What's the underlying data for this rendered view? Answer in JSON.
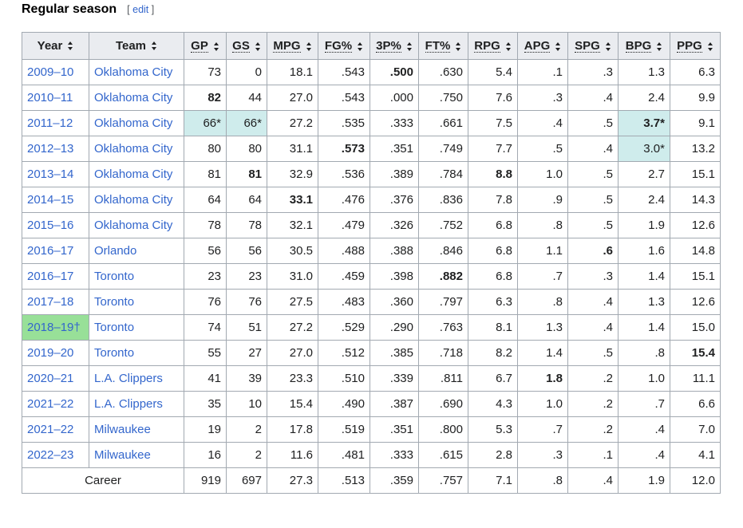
{
  "section": {
    "title": "Regular season",
    "edit_open": "[",
    "edit_label": "edit",
    "edit_close": "]"
  },
  "columns": [
    "Year",
    "Team",
    "GP",
    "GS",
    "MPG",
    "FG%",
    "3P%",
    "FT%",
    "RPG",
    "APG",
    "SPG",
    "BPG",
    "PPG"
  ],
  "colors": {
    "league_leader": "#cfecec",
    "champion": "#98e098",
    "link": "#3366cc",
    "header_bg": "#eaecf0",
    "border": "#a2a9b1"
  },
  "rows": [
    {
      "year": "2009–10",
      "team": "Oklahoma City",
      "gp": "73",
      "gs": "0",
      "mpg": "18.1",
      "fg": ".543",
      "tp": ".500",
      "ft": ".630",
      "rpg": "5.4",
      "apg": ".1",
      "spg": ".3",
      "bpg": "1.3",
      "ppg": "6.3"
    },
    {
      "year": "2010–11",
      "team": "Oklahoma City",
      "gp": "82",
      "gs": "44",
      "mpg": "27.0",
      "fg": ".543",
      "tp": ".000",
      "ft": ".750",
      "rpg": "7.6",
      "apg": ".3",
      "spg": ".4",
      "bpg": "2.4",
      "ppg": "9.9"
    },
    {
      "year": "2011–12",
      "team": "Oklahoma City",
      "gp": "66*",
      "gs": "66*",
      "mpg": "27.2",
      "fg": ".535",
      "tp": ".333",
      "ft": ".661",
      "rpg": "7.5",
      "apg": ".4",
      "spg": ".5",
      "bpg": "3.7*",
      "ppg": "9.1"
    },
    {
      "year": "2012–13",
      "team": "Oklahoma City",
      "gp": "80",
      "gs": "80",
      "mpg": "31.1",
      "fg": ".573",
      "tp": ".351",
      "ft": ".749",
      "rpg": "7.7",
      "apg": ".5",
      "spg": ".4",
      "bpg": "3.0*",
      "ppg": "13.2"
    },
    {
      "year": "2013–14",
      "team": "Oklahoma City",
      "gp": "81",
      "gs": "81",
      "mpg": "32.9",
      "fg": ".536",
      "tp": ".389",
      "ft": ".784",
      "rpg": "8.8",
      "apg": "1.0",
      "spg": ".5",
      "bpg": "2.7",
      "ppg": "15.1"
    },
    {
      "year": "2014–15",
      "team": "Oklahoma City",
      "gp": "64",
      "gs": "64",
      "mpg": "33.1",
      "fg": ".476",
      "tp": ".376",
      "ft": ".836",
      "rpg": "7.8",
      "apg": ".9",
      "spg": ".5",
      "bpg": "2.4",
      "ppg": "14.3"
    },
    {
      "year": "2015–16",
      "team": "Oklahoma City",
      "gp": "78",
      "gs": "78",
      "mpg": "32.1",
      "fg": ".479",
      "tp": ".326",
      "ft": ".752",
      "rpg": "6.8",
      "apg": ".8",
      "spg": ".5",
      "bpg": "1.9",
      "ppg": "12.6"
    },
    {
      "year": "2016–17",
      "team": "Orlando",
      "gp": "56",
      "gs": "56",
      "mpg": "30.5",
      "fg": ".488",
      "tp": ".388",
      "ft": ".846",
      "rpg": "6.8",
      "apg": "1.1",
      "spg": ".6",
      "bpg": "1.6",
      "ppg": "14.8"
    },
    {
      "year": "2016–17",
      "team": "Toronto",
      "gp": "23",
      "gs": "23",
      "mpg": "31.0",
      "fg": ".459",
      "tp": ".398",
      "ft": ".882",
      "rpg": "6.8",
      "apg": ".7",
      "spg": ".3",
      "bpg": "1.4",
      "ppg": "15.1"
    },
    {
      "year": "2017–18",
      "team": "Toronto",
      "gp": "76",
      "gs": "76",
      "mpg": "27.5",
      "fg": ".483",
      "tp": ".360",
      "ft": ".797",
      "rpg": "6.3",
      "apg": ".8",
      "spg": ".4",
      "bpg": "1.3",
      "ppg": "12.6"
    },
    {
      "year": "2018–19†",
      "team": "Toronto",
      "gp": "74",
      "gs": "51",
      "mpg": "27.2",
      "fg": ".529",
      "tp": ".290",
      "ft": ".763",
      "rpg": "8.1",
      "apg": "1.3",
      "spg": ".4",
      "bpg": "1.4",
      "ppg": "15.0"
    },
    {
      "year": "2019–20",
      "team": "Toronto",
      "gp": "55",
      "gs": "27",
      "mpg": "27.0",
      "fg": ".512",
      "tp": ".385",
      "ft": ".718",
      "rpg": "8.2",
      "apg": "1.4",
      "spg": ".5",
      "bpg": ".8",
      "ppg": "15.4"
    },
    {
      "year": "2020–21",
      "team": "L.A. Clippers",
      "gp": "41",
      "gs": "39",
      "mpg": "23.3",
      "fg": ".510",
      "tp": ".339",
      "ft": ".811",
      "rpg": "6.7",
      "apg": "1.8",
      "spg": ".2",
      "bpg": "1.0",
      "ppg": "11.1"
    },
    {
      "year": "2021–22",
      "team": "L.A. Clippers",
      "gp": "35",
      "gs": "10",
      "mpg": "15.4",
      "fg": ".490",
      "tp": ".387",
      "ft": ".690",
      "rpg": "4.3",
      "apg": "1.0",
      "spg": ".2",
      "bpg": ".7",
      "ppg": "6.6"
    },
    {
      "year": "2021–22",
      "team": "Milwaukee",
      "gp": "19",
      "gs": "2",
      "mpg": "17.8",
      "fg": ".519",
      "tp": ".351",
      "ft": ".800",
      "rpg": "5.3",
      "apg": ".7",
      "spg": ".2",
      "bpg": ".4",
      "ppg": "7.0"
    },
    {
      "year": "2022–23",
      "team": "Milwaukee",
      "gp": "16",
      "gs": "2",
      "mpg": "11.6",
      "fg": ".481",
      "tp": ".333",
      "ft": ".615",
      "rpg": "2.8",
      "apg": ".3",
      "spg": ".1",
      "bpg": ".4",
      "ppg": "4.1"
    }
  ],
  "career": {
    "label": "Career",
    "gp": "919",
    "gs": "697",
    "mpg": "27.3",
    "fg": ".513",
    "tp": ".359",
    "ft": ".757",
    "rpg": "7.1",
    "apg": ".8",
    "spg": ".4",
    "bpg": "1.9",
    "ppg": "12.0"
  }
}
